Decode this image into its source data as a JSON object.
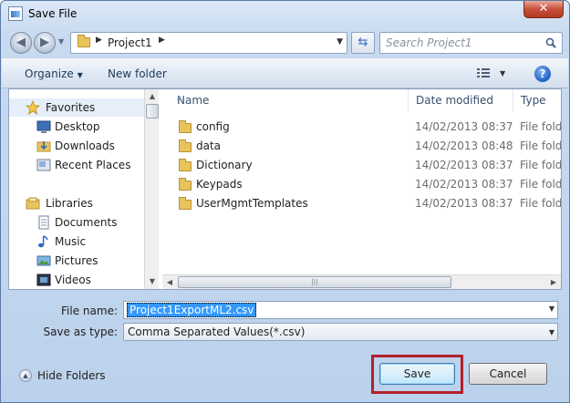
{
  "window": {
    "title": "Save File",
    "close_glyph": "✕"
  },
  "address_bar": {
    "crumbs": [
      "Project1"
    ],
    "search_placeholder": "Search Project1"
  },
  "toolbar": {
    "organize": "Organize",
    "new_folder": "New folder"
  },
  "nav_pane": {
    "items": [
      {
        "label": "Favorites",
        "icon": "star-icon",
        "group": true
      },
      {
        "label": "Desktop",
        "icon": "desktop-icon"
      },
      {
        "label": "Downloads",
        "icon": "downloads-folder-icon"
      },
      {
        "label": "Recent Places",
        "icon": "recent-places-icon"
      },
      {
        "label": "Libraries",
        "icon": "libraries-icon",
        "group": true
      },
      {
        "label": "Documents",
        "icon": "documents-icon"
      },
      {
        "label": "Music",
        "icon": "music-icon"
      },
      {
        "label": "Pictures",
        "icon": "pictures-icon"
      },
      {
        "label": "Videos",
        "icon": "videos-icon"
      }
    ]
  },
  "file_list": {
    "columns": {
      "name": "Name",
      "date": "Date modified",
      "type": "Type"
    },
    "rows": [
      {
        "name": "config",
        "date": "14/02/2013 08:37",
        "type": "File folder"
      },
      {
        "name": "data",
        "date": "14/02/2013 08:48",
        "type": "File folder"
      },
      {
        "name": "Dictionary",
        "date": "14/02/2013 08:37",
        "type": "File folder"
      },
      {
        "name": "Keypads",
        "date": "14/02/2013 08:37",
        "type": "File folder"
      },
      {
        "name": "UserMgmtTemplates",
        "date": "14/02/2013 08:37",
        "type": "File folder"
      }
    ]
  },
  "form": {
    "file_name_label": "File name:",
    "file_name_value": "Project1ExportML2.csv",
    "save_type_label": "Save as type:",
    "save_type_value": "Comma Separated Values(*.csv)"
  },
  "footer": {
    "hide_folders": "Hide Folders",
    "save": "Save",
    "cancel": "Cancel"
  },
  "colors": {
    "highlight_border": "#b2202a",
    "selection": "#3399ff"
  }
}
